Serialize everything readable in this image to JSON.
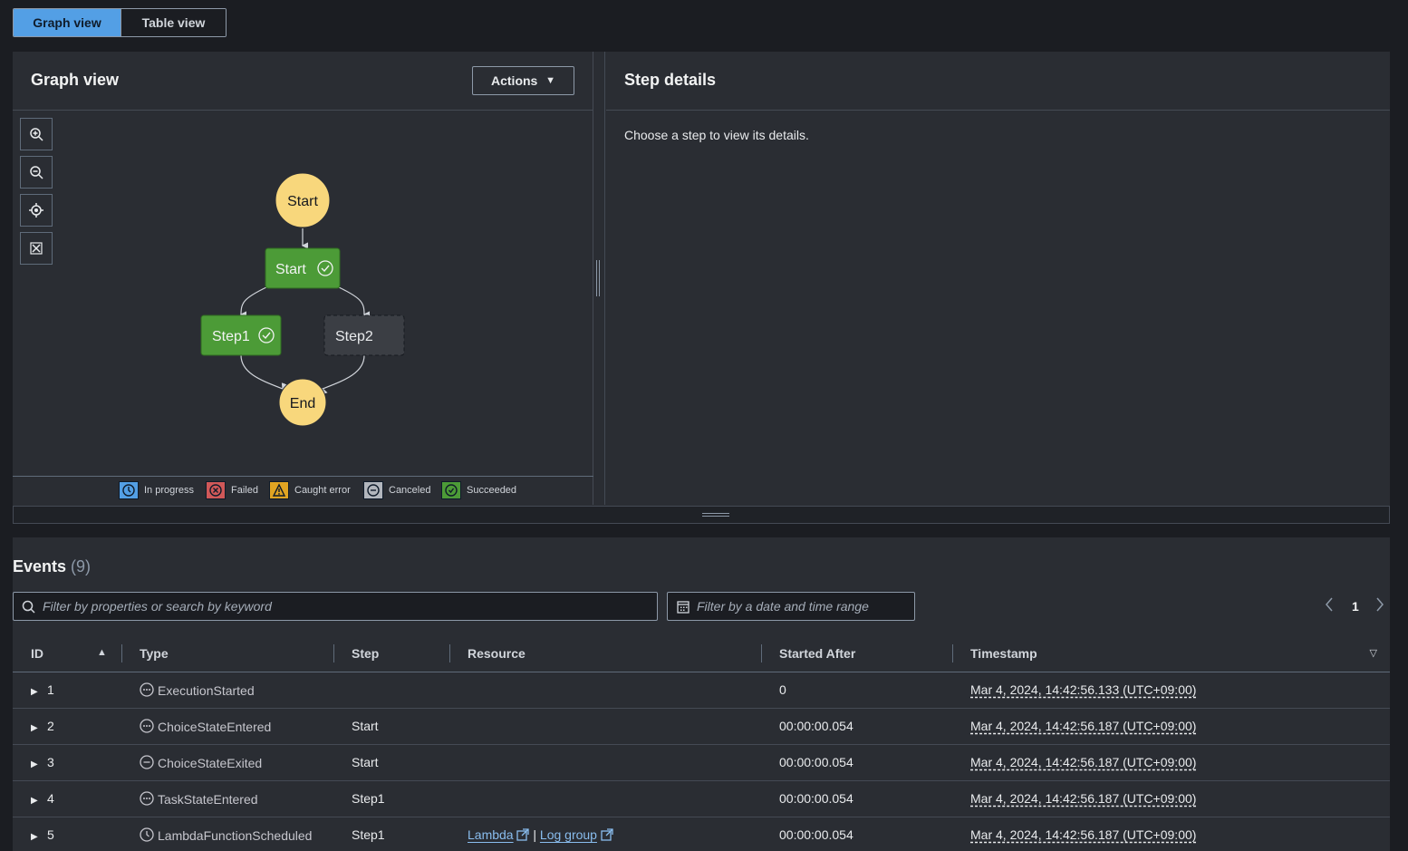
{
  "view_toggle": {
    "graph": "Graph view",
    "table": "Table view"
  },
  "graph_panel": {
    "title": "Graph view",
    "actions_label": "Actions"
  },
  "graph": {
    "nodes": [
      {
        "label": "Start",
        "kind": "terminal"
      },
      {
        "label": "Start",
        "kind": "state",
        "status": "succeeded"
      },
      {
        "label": "Step1",
        "kind": "state",
        "status": "succeeded"
      },
      {
        "label": "Step2",
        "kind": "state",
        "status": "not-run"
      },
      {
        "label": "End",
        "kind": "terminal"
      }
    ]
  },
  "legend": [
    "In progress",
    "Failed",
    "Caught error",
    "Canceled",
    "Succeeded"
  ],
  "colors": {
    "accent": "#539fe5",
    "succeeded": "#4c9b37",
    "terminal": "#f8d77c",
    "failed": "#d05858",
    "caught": "#e0a422",
    "inprogress": "#539fe5",
    "canceled": "#b2b6bd"
  },
  "step_details": {
    "title": "Step details",
    "message": "Choose a step to view its details."
  },
  "events": {
    "title": "Events",
    "count": "(9)",
    "search_placeholder": "Filter by properties or search by keyword",
    "date_placeholder": "Filter by a date and time range",
    "page": "1",
    "columns": [
      "ID",
      "Type",
      "Step",
      "Resource",
      "Started After",
      "Timestamp"
    ],
    "rows": [
      {
        "id": "1",
        "type": "ExecutionStarted",
        "icon": "dots",
        "step": "",
        "resource": "",
        "started_after": "0",
        "timestamp": "Mar 4, 2024, 14:42:56.133 (UTC+09:00)"
      },
      {
        "id": "2",
        "type": "ChoiceStateEntered",
        "icon": "dots",
        "step": "Start",
        "resource": "",
        "started_after": "00:00:00.054",
        "timestamp": "Mar 4, 2024, 14:42:56.187 (UTC+09:00)"
      },
      {
        "id": "3",
        "type": "ChoiceStateExited",
        "icon": "minus",
        "step": "Start",
        "resource": "",
        "started_after": "00:00:00.054",
        "timestamp": "Mar 4, 2024, 14:42:56.187 (UTC+09:00)"
      },
      {
        "id": "4",
        "type": "TaskStateEntered",
        "icon": "dots",
        "step": "Step1",
        "resource": "",
        "started_after": "00:00:00.054",
        "timestamp": "Mar 4, 2024, 14:42:56.187 (UTC+09:00)"
      },
      {
        "id": "5",
        "type": "LambdaFunctionScheduled",
        "icon": "clock",
        "step": "Step1",
        "resource": "Lambda",
        "resource2": "Log group",
        "started_after": "00:00:00.054",
        "timestamp": "Mar 4, 2024, 14:42:56.187 (UTC+09:00)"
      }
    ]
  }
}
